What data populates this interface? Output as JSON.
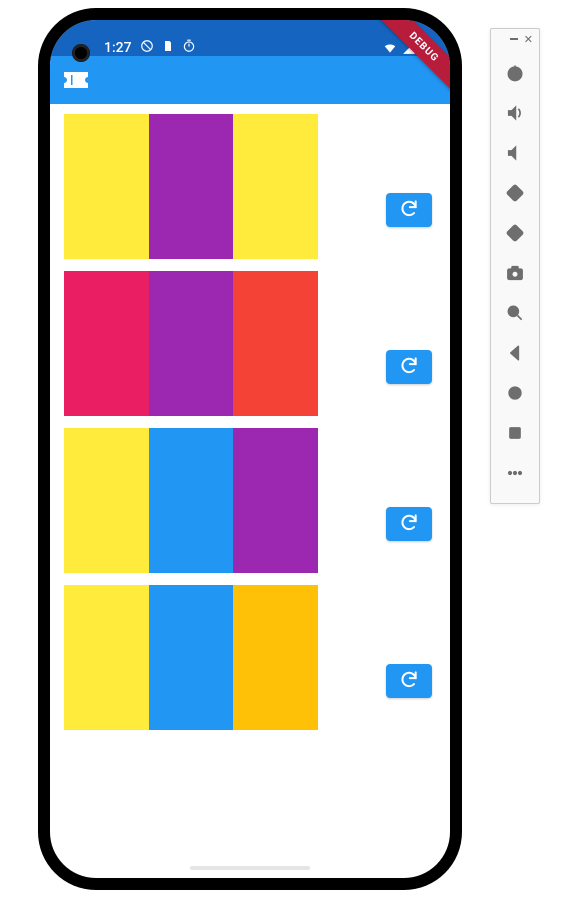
{
  "status": {
    "time": "1:27",
    "icons_left": [
      "no-sim-icon",
      "sd-card-icon",
      "timer-icon"
    ],
    "icons_right": [
      "wifi-icon",
      "signal-icon",
      "battery-icon"
    ]
  },
  "debug_label": "DEBUG",
  "app_bar": {
    "leading_icon": "ticket-icon"
  },
  "rows": [
    {
      "colors": [
        "#ffeb3b",
        "#9c27b0",
        "#ffeb3b"
      ],
      "button_icon": "refresh-icon"
    },
    {
      "colors": [
        "#e91e63",
        "#9c27b0",
        "#f44336"
      ],
      "button_icon": "refresh-icon"
    },
    {
      "colors": [
        "#ffeb3b",
        "#2196f3",
        "#9c27b0"
      ],
      "button_icon": "refresh-icon"
    },
    {
      "colors": [
        "#ffeb3b",
        "#2196f3",
        "#ffc107"
      ],
      "button_icon": "refresh-icon"
    }
  ],
  "emulator_panel": {
    "minimize": "minimize",
    "close": "close",
    "items": [
      "power-icon",
      "volume-up-icon",
      "volume-down-icon",
      "rotate-left-icon",
      "rotate-right-icon",
      "camera-icon",
      "zoom-in-icon",
      "back-icon",
      "home-icon",
      "overview-icon",
      "more-icon"
    ]
  }
}
